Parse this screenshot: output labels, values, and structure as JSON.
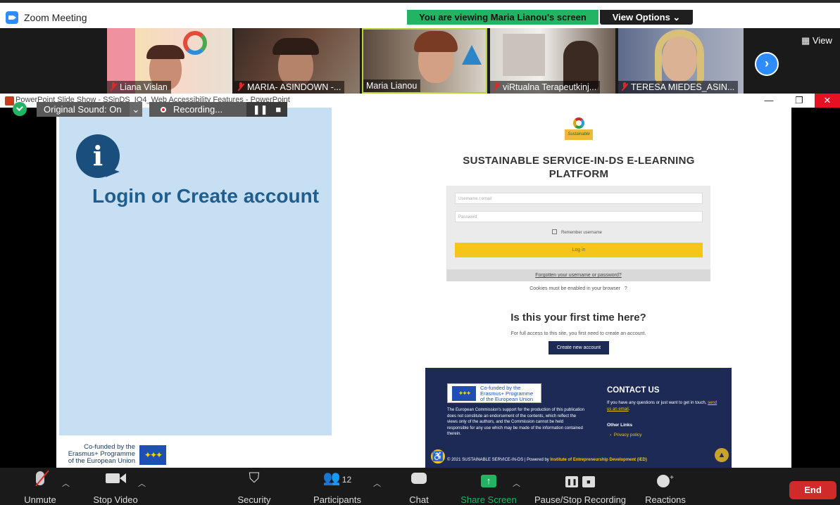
{
  "window": {
    "title": "Zoom Meeting"
  },
  "share_banner": {
    "viewing": "You are viewing Maria Lianou's screen",
    "view_options": "View Options ⌄"
  },
  "participants": [
    {
      "name": "Liana Vislan",
      "muted": true
    },
    {
      "name": "MARIA- ASINDOWN -...",
      "muted": true
    },
    {
      "name": "Maria Lianou",
      "muted": false
    },
    {
      "name": "viRtualna Terapeutkinj...",
      "muted": true
    },
    {
      "name": "TERESA MIEDES_ASIN...",
      "muted": true
    }
  ],
  "strip_controls": {
    "next_icon": "chevron-right-icon",
    "view_label": "View"
  },
  "powerpoint": {
    "title": "PowerPoint Slide Show - SSinDS_IO4_Web Accessibility Features - PowerPoint"
  },
  "zoom_overlay": {
    "original_sound": "Original Sound: On",
    "recording": "Recording..."
  },
  "slide": {
    "title": "Login or Create account",
    "cofunded": [
      "Co-funded by the",
      "Erasmus+ Programme",
      "of the European Union"
    ]
  },
  "site": {
    "logo_text": "Sustainable",
    "title": "SUSTAINABLE SERVICE-IN-DS E-LEARNING PLATFORM",
    "username_placeholder": "Username / email",
    "password_placeholder": "Password",
    "remember": "Remember username",
    "login": "Log in",
    "forgot": "Forgotten your username or password?",
    "cookies": "Cookies must be enabled in your browser",
    "first_time": "Is this your first time here?",
    "full_access": "For full access to this site, you first need to create an account.",
    "create": "Create new account",
    "footer": {
      "eu_text": [
        "Co-funded by the",
        "Erasmus+ Programme",
        "of the European Union"
      ],
      "disclaimer": "The European Commission's support for the production of this publication does not constitute an endorsement of the contents, which reflect the views only of the authors, and the Commission cannot be held responsible for any use which may be made of the information contained therein.",
      "contact_title": "CONTACT US",
      "contact_text": "If you have any questions or just want to get in touch,",
      "contact_link": "send us an email",
      "other_links": "Other Links",
      "privacy": "Privacy policy",
      "copyright": "© 2021 SUSTAINABLE SERVICE-IN-DS | Powered by",
      "powered_by": "Institute of Entrepreneurship Development (iED)"
    }
  },
  "toolbar": {
    "unmute": "Unmute",
    "stop_video": "Stop Video",
    "security": "Security",
    "participants": "Participants",
    "participants_count": "12",
    "chat": "Chat",
    "share_screen": "Share Screen",
    "pause_recording": "Pause/Stop Recording",
    "reactions": "Reactions",
    "end": "End"
  },
  "colors": {
    "zoom_blue": "#2d8cff",
    "share_green": "#23b463",
    "end_red": "#d12a2a",
    "slide_blue": "#c6dff2",
    "site_navy": "#1d2a55",
    "site_yellow": "#f5c518"
  }
}
